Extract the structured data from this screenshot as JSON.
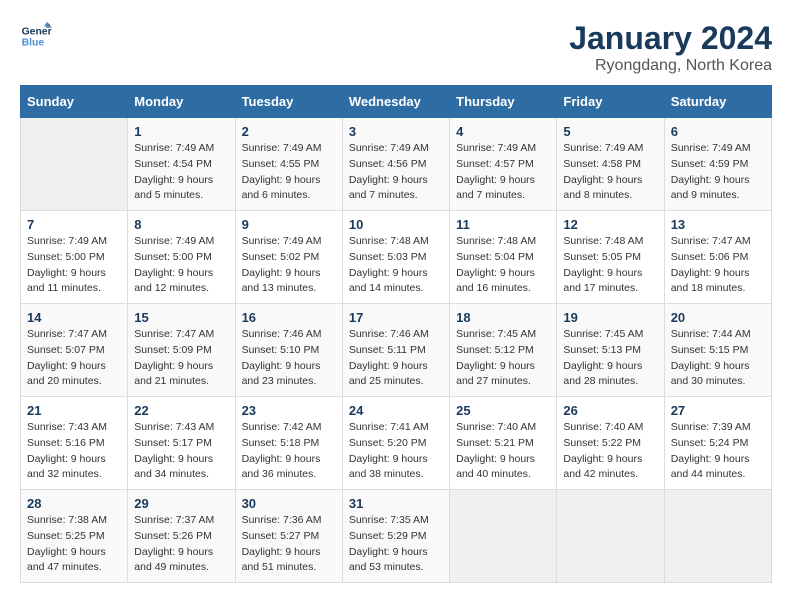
{
  "logo": {
    "line1": "General",
    "line2": "Blue"
  },
  "title": "January 2024",
  "location": "Ryongdang, North Korea",
  "days_of_week": [
    "Sunday",
    "Monday",
    "Tuesday",
    "Wednesday",
    "Thursday",
    "Friday",
    "Saturday"
  ],
  "weeks": [
    [
      {
        "day": "",
        "info": ""
      },
      {
        "day": "1",
        "info": "Sunrise: 7:49 AM\nSunset: 4:54 PM\nDaylight: 9 hours\nand 5 minutes."
      },
      {
        "day": "2",
        "info": "Sunrise: 7:49 AM\nSunset: 4:55 PM\nDaylight: 9 hours\nand 6 minutes."
      },
      {
        "day": "3",
        "info": "Sunrise: 7:49 AM\nSunset: 4:56 PM\nDaylight: 9 hours\nand 7 minutes."
      },
      {
        "day": "4",
        "info": "Sunrise: 7:49 AM\nSunset: 4:57 PM\nDaylight: 9 hours\nand 7 minutes."
      },
      {
        "day": "5",
        "info": "Sunrise: 7:49 AM\nSunset: 4:58 PM\nDaylight: 9 hours\nand 8 minutes."
      },
      {
        "day": "6",
        "info": "Sunrise: 7:49 AM\nSunset: 4:59 PM\nDaylight: 9 hours\nand 9 minutes."
      }
    ],
    [
      {
        "day": "7",
        "info": ""
      },
      {
        "day": "8",
        "info": "Sunrise: 7:49 AM\nSunset: 5:00 PM\nDaylight: 9 hours\nand 12 minutes."
      },
      {
        "day": "9",
        "info": "Sunrise: 7:49 AM\nSunset: 5:02 PM\nDaylight: 9 hours\nand 13 minutes."
      },
      {
        "day": "10",
        "info": "Sunrise: 7:48 AM\nSunset: 5:03 PM\nDaylight: 9 hours\nand 14 minutes."
      },
      {
        "day": "11",
        "info": "Sunrise: 7:48 AM\nSunset: 5:04 PM\nDaylight: 9 hours\nand 16 minutes."
      },
      {
        "day": "12",
        "info": "Sunrise: 7:48 AM\nSunset: 5:05 PM\nDaylight: 9 hours\nand 17 minutes."
      },
      {
        "day": "13",
        "info": "Sunrise: 7:47 AM\nSunset: 5:06 PM\nDaylight: 9 hours\nand 18 minutes."
      }
    ],
    [
      {
        "day": "14",
        "info": ""
      },
      {
        "day": "15",
        "info": "Sunrise: 7:47 AM\nSunset: 5:09 PM\nDaylight: 9 hours\nand 21 minutes."
      },
      {
        "day": "16",
        "info": "Sunrise: 7:46 AM\nSunset: 5:10 PM\nDaylight: 9 hours\nand 23 minutes."
      },
      {
        "day": "17",
        "info": "Sunrise: 7:46 AM\nSunset: 5:11 PM\nDaylight: 9 hours\nand 25 minutes."
      },
      {
        "day": "18",
        "info": "Sunrise: 7:45 AM\nSunset: 5:12 PM\nDaylight: 9 hours\nand 27 minutes."
      },
      {
        "day": "19",
        "info": "Sunrise: 7:45 AM\nSunset: 5:13 PM\nDaylight: 9 hours\nand 28 minutes."
      },
      {
        "day": "20",
        "info": "Sunrise: 7:44 AM\nSunset: 5:15 PM\nDaylight: 9 hours\nand 30 minutes."
      }
    ],
    [
      {
        "day": "21",
        "info": ""
      },
      {
        "day": "22",
        "info": "Sunrise: 7:43 AM\nSunset: 5:17 PM\nDaylight: 9 hours\nand 34 minutes."
      },
      {
        "day": "23",
        "info": "Sunrise: 7:42 AM\nSunset: 5:18 PM\nDaylight: 9 hours\nand 36 minutes."
      },
      {
        "day": "24",
        "info": "Sunrise: 7:41 AM\nSunset: 5:20 PM\nDaylight: 9 hours\nand 38 minutes."
      },
      {
        "day": "25",
        "info": "Sunrise: 7:40 AM\nSunset: 5:21 PM\nDaylight: 9 hours\nand 40 minutes."
      },
      {
        "day": "26",
        "info": "Sunrise: 7:40 AM\nSunset: 5:22 PM\nDaylight: 9 hours\nand 42 minutes."
      },
      {
        "day": "27",
        "info": "Sunrise: 7:39 AM\nSunset: 5:24 PM\nDaylight: 9 hours\nand 44 minutes."
      }
    ],
    [
      {
        "day": "28",
        "info": ""
      },
      {
        "day": "29",
        "info": "Sunrise: 7:37 AM\nSunset: 5:26 PM\nDaylight: 9 hours\nand 49 minutes."
      },
      {
        "day": "30",
        "info": "Sunrise: 7:36 AM\nSunset: 5:27 PM\nDaylight: 9 hours\nand 51 minutes."
      },
      {
        "day": "31",
        "info": "Sunrise: 7:35 AM\nSunset: 5:29 PM\nDaylight: 9 hours\nand 53 minutes."
      },
      {
        "day": "",
        "info": ""
      },
      {
        "day": "",
        "info": ""
      },
      {
        "day": "",
        "info": ""
      }
    ]
  ],
  "week1_sunday_info": "Sunrise: 7:49 AM\nSunset: 5:00 PM\nDaylight: 9 hours\nand 11 minutes.",
  "week2_sunday_info": "Sunrise: 7:49 AM\nSunset: 5:00 PM\nDaylight: 9 hours\nand 11 minutes.",
  "week3_sunday_info": "Sunrise: 7:47 AM\nSunset: 5:07 PM\nDaylight: 9 hours\nand 20 minutes.",
  "week4_sunday_info": "Sunrise: 7:43 AM\nSunset: 5:16 PM\nDaylight: 9 hours\nand 32 minutes.",
  "week5_sunday_info": "Sunrise: 7:38 AM\nSunset: 5:25 PM\nDaylight: 9 hours\nand 47 minutes."
}
